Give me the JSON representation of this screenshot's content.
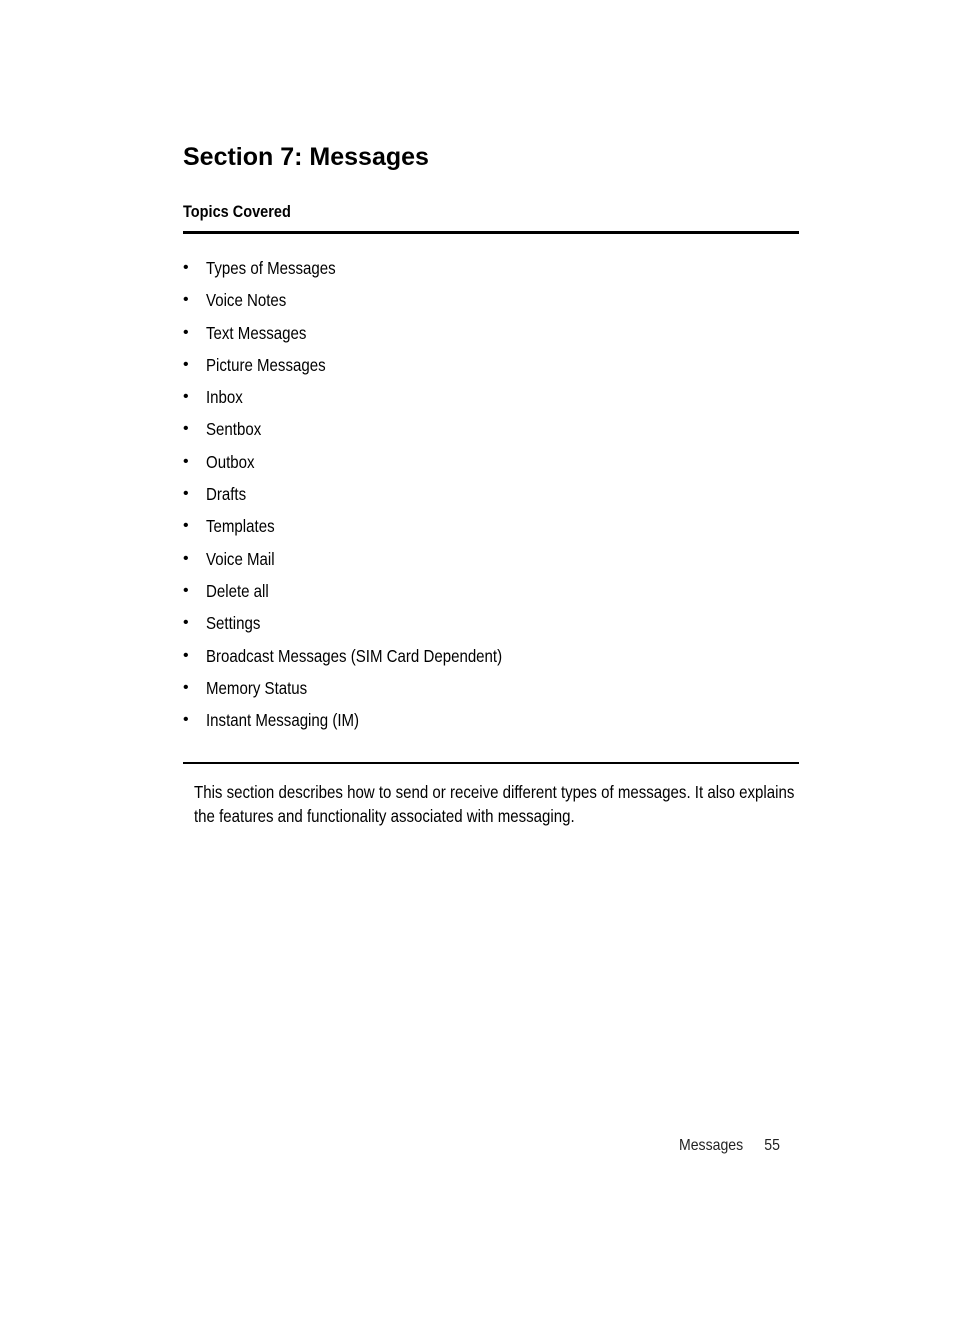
{
  "section_title": "Section 7: Messages",
  "topics_heading": "Topics Covered",
  "topics": [
    "Types of Messages",
    "Voice Notes",
    "Text Messages",
    "Picture Messages",
    "Inbox",
    "Sentbox",
    "Outbox",
    "Drafts",
    "Templates",
    "Voice Mail",
    "Delete all",
    "Settings",
    "Broadcast Messages (SIM Card Dependent)",
    "Memory Status",
    "Instant Messaging (IM)"
  ],
  "bullet_glyph": "•",
  "intro_text": "This section describes how to send or receive different types of messages. It also explains the features and functionality associated with messaging.",
  "footer": {
    "section_name": "Messages",
    "page_number": "55"
  }
}
